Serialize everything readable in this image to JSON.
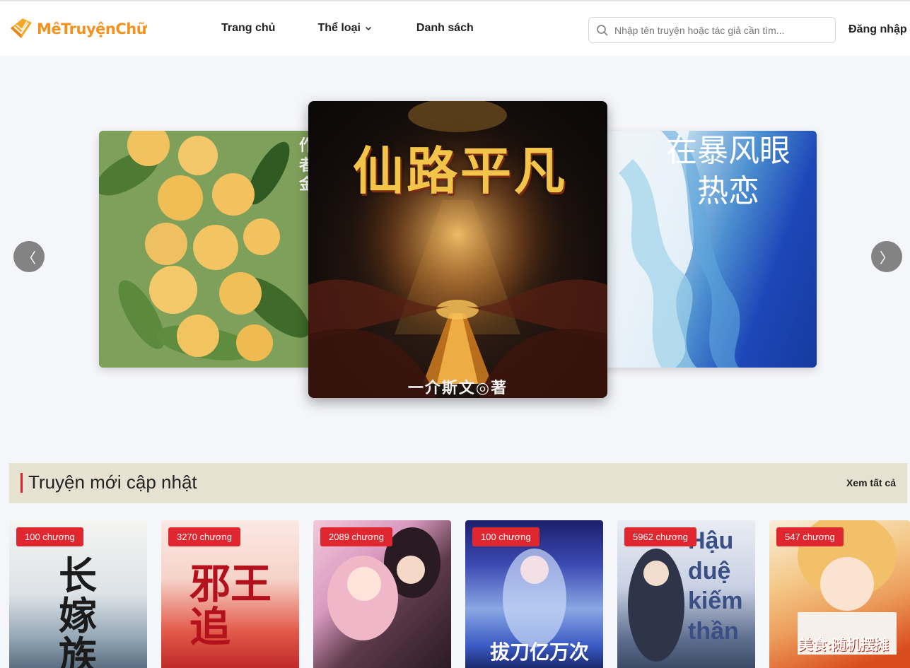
{
  "header": {
    "logo_text": "MêTruyệnChữ",
    "nav": [
      {
        "label": "Trang chủ"
      },
      {
        "label": "Thể loại"
      },
      {
        "label": "Danh sách"
      }
    ],
    "search": {
      "placeholder": "Nhập tên truyện hoặc tác giả cần tìm..."
    },
    "login_label": "Đăng nhập"
  },
  "carousel": {
    "prev_label": "〈",
    "next_label": "〉",
    "center_title": "仙路平凡",
    "center_author": "一介斯文◎著",
    "right_title": "在暴风眼热恋",
    "left_side_text": "作者金"
  },
  "section": {
    "title": "Truyện mới cập nhật",
    "more_label": "Xem tất cả"
  },
  "books": [
    {
      "badge": "100 chương",
      "cover_text": "长嫁族"
    },
    {
      "badge": "3270 chương",
      "cover_text": "邪王追"
    },
    {
      "badge": "2089 chương",
      "cover_text": ""
    },
    {
      "badge": "100 chương",
      "cover_text": "拔刀亿万次"
    },
    {
      "badge": "5962 chương",
      "cover_text": "Hậu duệ kiếm thần"
    },
    {
      "badge": "547 chương",
      "cover_text": "美食:随机摆摊"
    }
  ],
  "colors": {
    "brand": "#f5921e",
    "badge": "#e0262e",
    "section_bg": "#e7e1d1",
    "accent_bar": "#e11d2b"
  }
}
